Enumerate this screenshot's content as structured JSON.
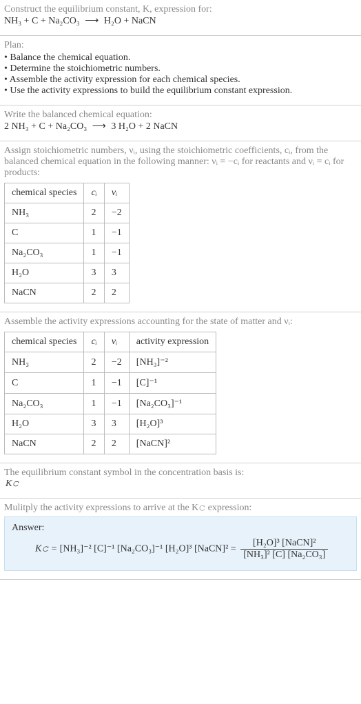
{
  "header": {
    "prompt": "Construct the equilibrium constant, K, expression for:",
    "equation_left": "NH₃ + C + Na₂CO₃",
    "equation_right": "H₂O + NaCN"
  },
  "plan": {
    "heading": "Plan:",
    "items": [
      "Balance the chemical equation.",
      "Determine the stoichiometric numbers.",
      "Assemble the activity expression for each chemical species.",
      "Use the activity expressions to build the equilibrium constant expression."
    ]
  },
  "balanced": {
    "heading": "Write the balanced chemical equation:",
    "left": "2 NH₃ + C + Na₂CO₃",
    "right": "3 H₂O + 2 NaCN"
  },
  "stoich": {
    "intro_a": "Assign stoichiometric numbers, νᵢ, using the stoichiometric coefficients, cᵢ, from the balanced chemical equation in the following manner: νᵢ = −cᵢ for reactants and νᵢ = cᵢ for products:",
    "headers": {
      "species": "chemical species",
      "ci": "cᵢ",
      "vi": "νᵢ"
    },
    "rows": [
      {
        "species": "NH₃",
        "ci": "2",
        "vi": "−2"
      },
      {
        "species": "C",
        "ci": "1",
        "vi": "−1"
      },
      {
        "species": "Na₂CO₃",
        "ci": "1",
        "vi": "−1"
      },
      {
        "species": "H₂O",
        "ci": "3",
        "vi": "3"
      },
      {
        "species": "NaCN",
        "ci": "2",
        "vi": "2"
      }
    ]
  },
  "activity": {
    "intro": "Assemble the activity expressions accounting for the state of matter and νᵢ:",
    "headers": {
      "species": "chemical species",
      "ci": "cᵢ",
      "vi": "νᵢ",
      "expr": "activity expression"
    },
    "rows": [
      {
        "species": "NH₃",
        "ci": "2",
        "vi": "−2",
        "expr": "[NH₃]⁻²"
      },
      {
        "species": "C",
        "ci": "1",
        "vi": "−1",
        "expr": "[C]⁻¹"
      },
      {
        "species": "Na₂CO₃",
        "ci": "1",
        "vi": "−1",
        "expr": "[Na₂CO₃]⁻¹"
      },
      {
        "species": "H₂O",
        "ci": "3",
        "vi": "3",
        "expr": "[H₂O]³"
      },
      {
        "species": "NaCN",
        "ci": "2",
        "vi": "2",
        "expr": "[NaCN]²"
      }
    ]
  },
  "symbol": {
    "line1": "The equilibrium constant symbol in the concentration basis is:",
    "line2": "K𝚌"
  },
  "final": {
    "intro": "Mulitply the activity expressions to arrive at the K𝚌 expression:",
    "answer_label": "Answer:",
    "kc_prefix": "K𝚌 = ",
    "flat_product": "[NH₃]⁻² [C]⁻¹ [Na₂CO₃]⁻¹ [H₂O]³ [NaCN]² = ",
    "frac_num": "[H₂O]³ [NaCN]²",
    "frac_den": "[NH₃]² [C] [Na₂CO₃]"
  }
}
